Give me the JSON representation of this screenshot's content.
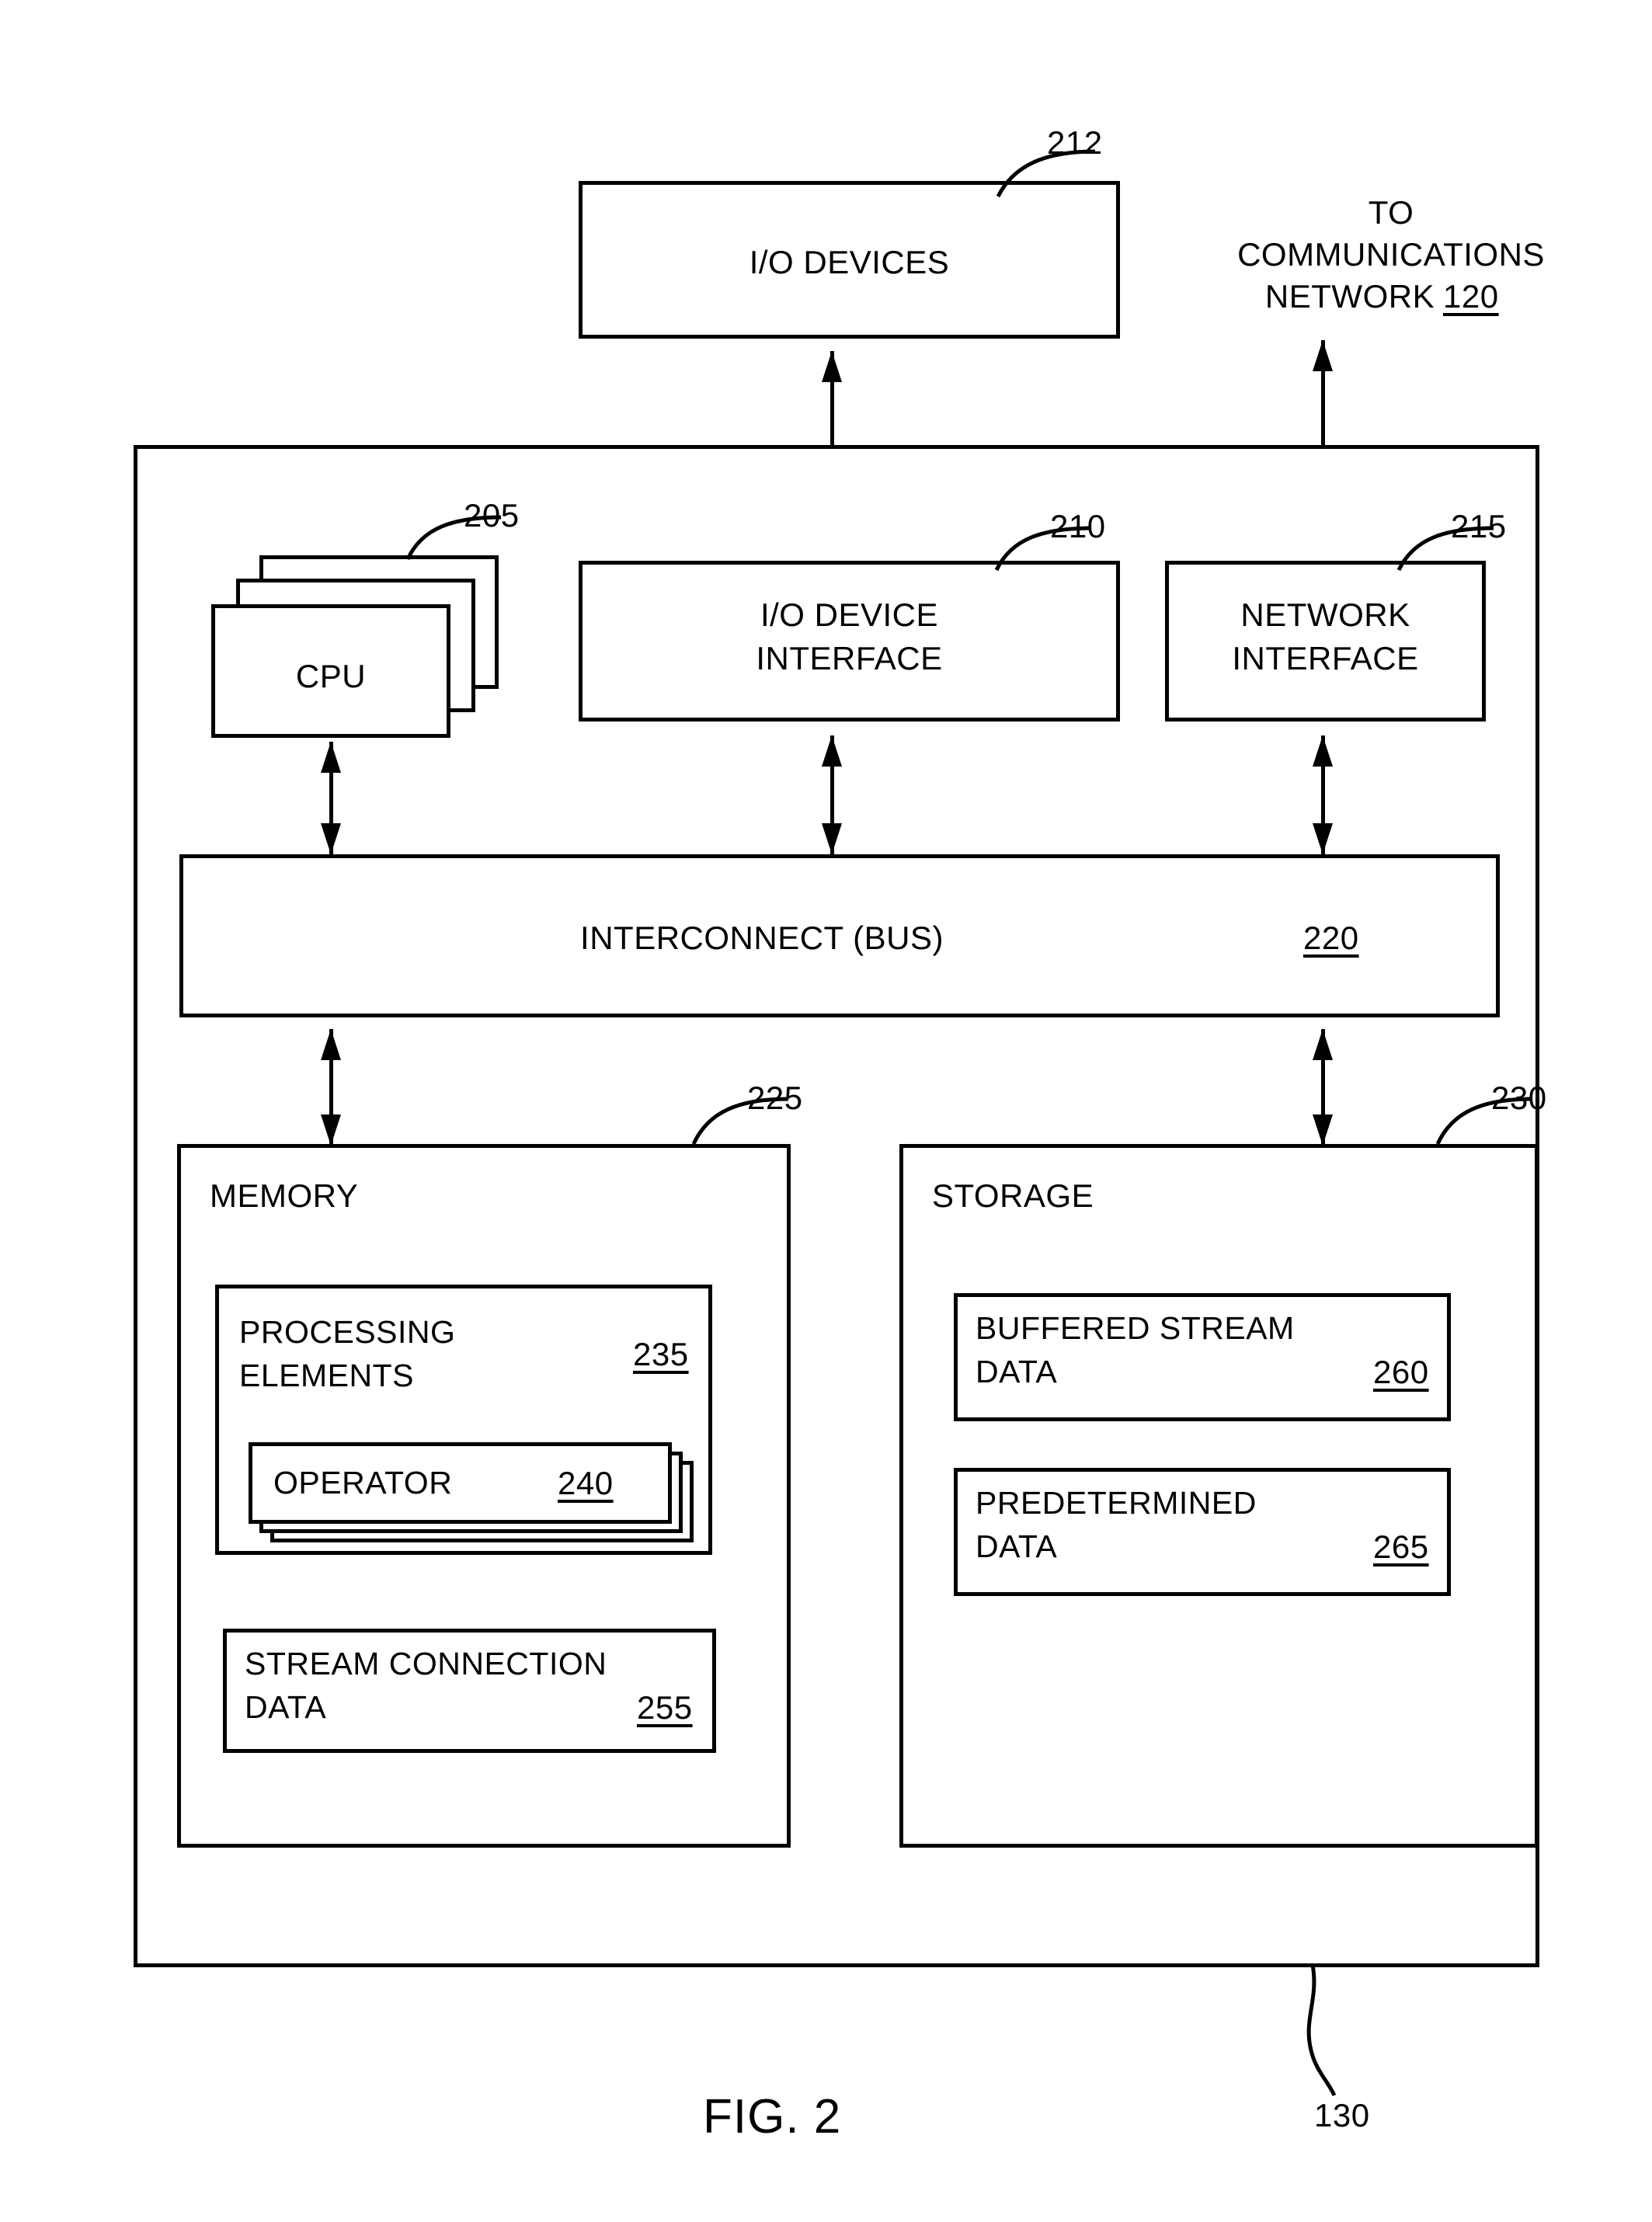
{
  "figure": {
    "caption": "FIG. 2",
    "system_ref": "130"
  },
  "external": {
    "io_devices": {
      "label": "I/O DEVICES",
      "ref": "212"
    },
    "comm_network": {
      "line1": "TO",
      "line2": "COMMUNICATIONS",
      "line3": "NETWORK",
      "ref": "120"
    }
  },
  "system": {
    "cpu": {
      "label": "CPU",
      "ref": "205"
    },
    "io_device_interface": {
      "line1": "I/O DEVICE",
      "line2": "INTERFACE",
      "ref": "210"
    },
    "network_interface": {
      "line1": "NETWORK",
      "line2": "INTERFACE",
      "ref": "215"
    },
    "interconnect": {
      "label": "INTERCONNECT (BUS)",
      "ref": "220"
    },
    "memory": {
      "label": "MEMORY",
      "ref": "225",
      "processing_elements": {
        "line1": "PROCESSING",
        "line2": "ELEMENTS",
        "ref": "235",
        "operator": {
          "label": "OPERATOR",
          "ref": "240"
        }
      },
      "stream_connection_data": {
        "line1": "STREAM CONNECTION",
        "line2": "DATA",
        "ref": "255"
      }
    },
    "storage": {
      "label": "STORAGE",
      "ref": "230",
      "buffered_stream_data": {
        "line1": "BUFFERED STREAM",
        "line2": "DATA",
        "ref": "260"
      },
      "predetermined_data": {
        "line1": "PREDETERMINED",
        "line2": "DATA",
        "ref": "265"
      }
    }
  },
  "colors": {
    "stroke": "#000000",
    "background": "#ffffff"
  }
}
